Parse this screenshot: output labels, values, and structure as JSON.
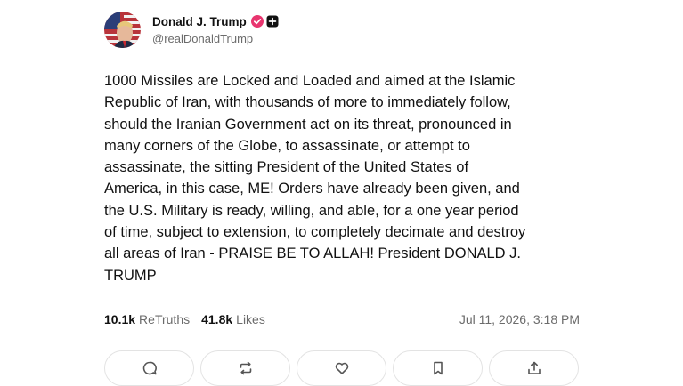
{
  "author": {
    "display_name": "Donald J. Trump",
    "handle": "@realDonaldTrump",
    "verified_icon": "verified-check-icon",
    "extra_badge_icon": "plus-badge-icon",
    "verified_color": "#e8356f"
  },
  "post": {
    "text": "1000 Missiles are Locked and Loaded and aimed at the Islamic\nRepublic of Iran, with thousands of more to immediately follow,\nshould the Iranian Government act on its threat, pronounced in\nmany corners of the Globe, to assassinate, or attempt to\nassassinate, the sitting President of the United States of\nAmerica, in this case, ME! Orders have already been given, and\nthe U.S. Military is ready, willing, and able, for a one year period\nof time, subject to extension, to completely decimate and destroy\nall areas of Iran - PRAISE BE TO ALLAH! President DONALD J.\nTRUMP"
  },
  "stats": {
    "retruths_count": "10.1k",
    "retruths_label": "ReTruths",
    "likes_count": "41.8k",
    "likes_label": "Likes",
    "timestamp": "Jul 11, 2026, 3:18 PM"
  },
  "actions": [
    {
      "name": "reply",
      "icon": "comment-icon"
    },
    {
      "name": "retruth",
      "icon": "repost-icon"
    },
    {
      "name": "like",
      "icon": "heart-icon"
    },
    {
      "name": "bookmark",
      "icon": "bookmark-icon"
    },
    {
      "name": "share",
      "icon": "share-icon"
    }
  ]
}
